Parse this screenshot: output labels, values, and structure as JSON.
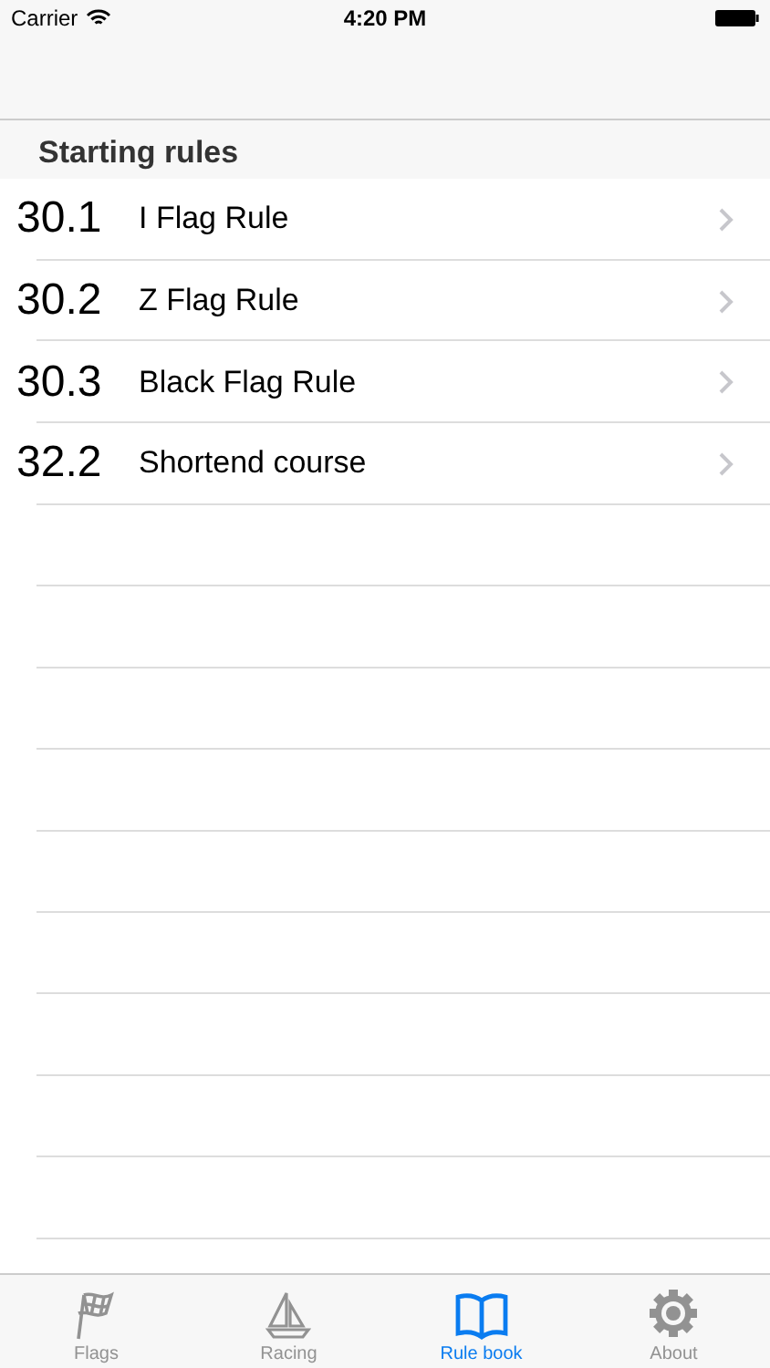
{
  "status_bar": {
    "carrier": "Carrier",
    "time": "4:20 PM"
  },
  "section": {
    "title": "Starting rules"
  },
  "rows": [
    {
      "number": "30.1",
      "title": "I Flag Rule"
    },
    {
      "number": "30.2",
      "title": "Z Flag Rule"
    },
    {
      "number": "30.3",
      "title": "Black Flag Rule"
    },
    {
      "number": "32.2",
      "title": "Shortend course"
    }
  ],
  "tabs": [
    {
      "kind": "flag",
      "label": "Flags",
      "selected": false
    },
    {
      "kind": "boat",
      "label": "Racing",
      "selected": false
    },
    {
      "kind": "book",
      "label": "Rule book",
      "selected": true
    },
    {
      "kind": "gear",
      "label": "About",
      "selected": false
    }
  ]
}
